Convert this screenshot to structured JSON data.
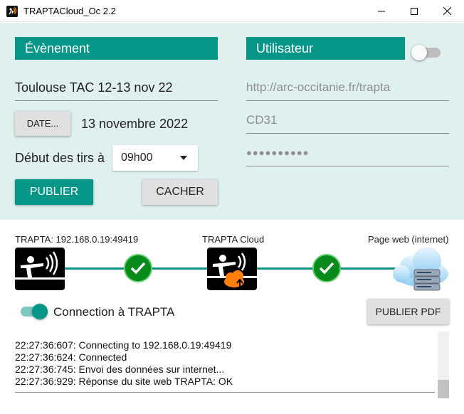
{
  "window": {
    "title": "TRAPTACloud_Oc 2.2"
  },
  "event": {
    "header": "Évènement",
    "name": "Toulouse TAC 12-13 nov 22",
    "date_button": "DATE...",
    "date_value": "13 novembre 2022",
    "start_label": "Début des tirs à",
    "start_time": "09h00",
    "publish_button": "PUBLIER",
    "hide_button": "CACHER"
  },
  "user": {
    "header": "Utilisateur",
    "toggle_on": false,
    "url": "http://arc-occitanie.fr/trapta",
    "login": "CD31",
    "password_mask": "●●●●●●●●●●"
  },
  "connection": {
    "trapta_label": "TRAPTA: 192.168.0.19:49419",
    "cloud_label": "TRAPTA Cloud",
    "web_label": "Page web (internet)",
    "toggle_on": true,
    "toggle_label": "Connection à TRAPTA",
    "pdf_button": "PUBLIER PDF"
  },
  "log": [
    "22:27:36:607: Connecting to 192.168.0.19:49419",
    "22:27:36:624: Connected",
    "22:27:36:745: Envoi des données sur internet...",
    "22:27:36:929: Réponse du site web TRAPTA: OK"
  ],
  "colors": {
    "accent": "#059688",
    "panel": "#dff0ef",
    "check": "#078a19"
  }
}
